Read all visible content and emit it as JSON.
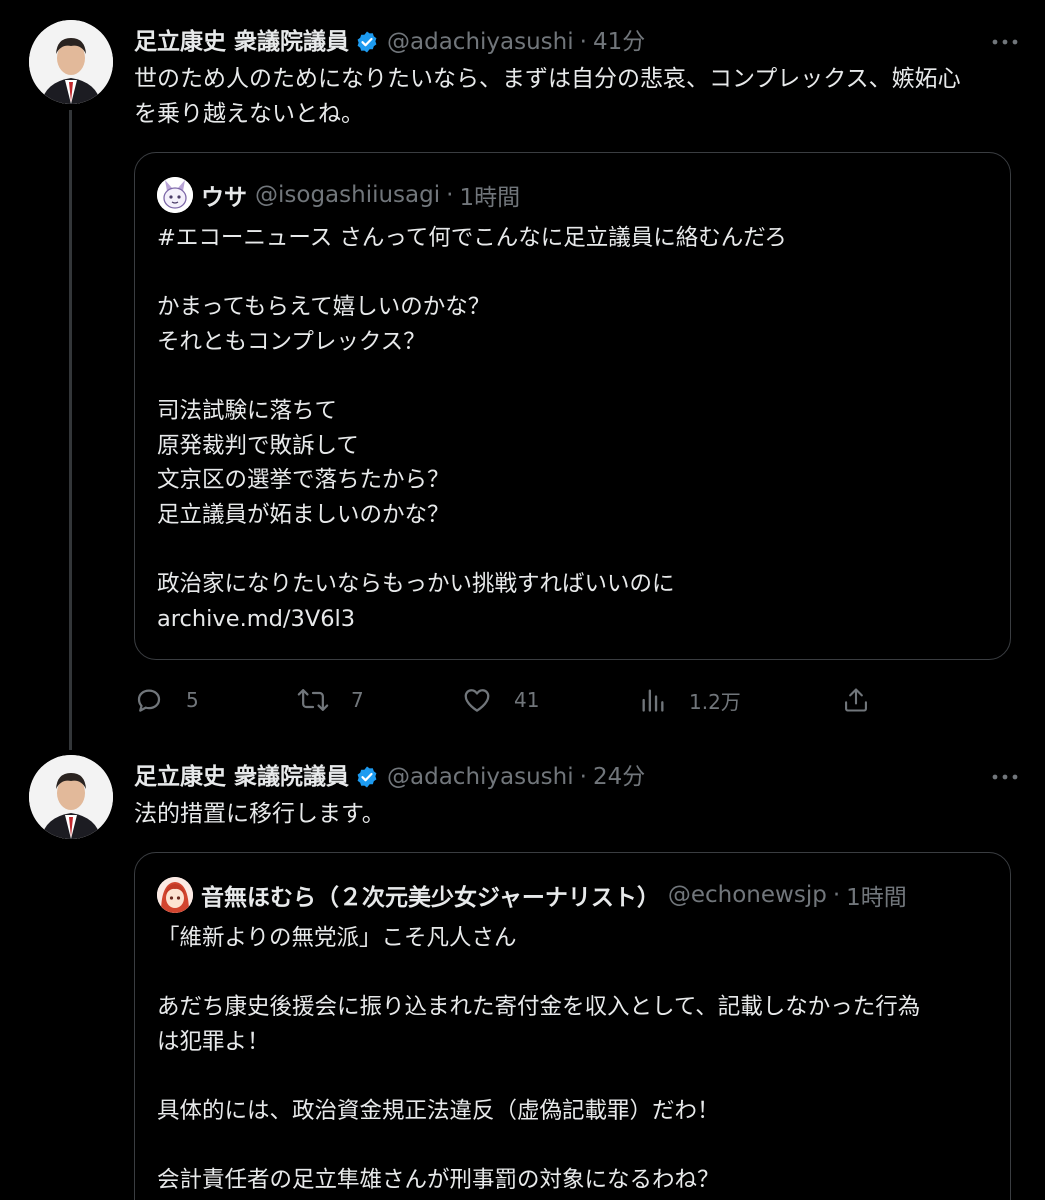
{
  "tweets": [
    {
      "author_name": "足立康史 衆議院議員",
      "handle": "@adachiyasushi",
      "separator": "·",
      "time": "41分",
      "text": "世のため人のためになりたいなら、まずは自分の悲哀、コンプレックス、嫉妬心\nを乗り越えないとね。",
      "quote": {
        "author_name": "ウサ",
        "handle": "@isogashiiusagi",
        "separator": "·",
        "time": "1時間",
        "text": "#エコーニュース さんって何でこんなに足立議員に絡むんだろ\n\nかまってもらえて嬉しいのかな？\nそれともコンプレックス？\n\n司法試験に落ちて\n原発裁判で敗訴して\n文京区の選挙で落ちたから？\n足立議員が妬ましいのかな？\n\n政治家になりたいならもっかい挑戦すればいいのに\narchive.md/3V6l3"
      },
      "actions": {
        "replies": "5",
        "retweets": "7",
        "likes": "41",
        "views": "1.2万"
      }
    },
    {
      "author_name": "足立康史 衆議院議員",
      "handle": "@adachiyasushi",
      "separator": "·",
      "time": "24分",
      "text": "法的措置に移行します。",
      "quote": {
        "author_name": "音無ほむら（２次元美少女ジャーナリスト）",
        "handle": "@echonewsjp",
        "separator": "·",
        "time": "1時間",
        "text": "「維新よりの無党派」こそ凡人さん\n\nあだち康史後援会に振り込まれた寄付金を収入として、記載しなかった行為\nは犯罪よ！\n\n具体的には、政治資金規正法違反（虚偽記載罪）だわ！\n\n会計責任者の足立隼雄さんが刑事罰の対象になるわね？"
      }
    }
  ],
  "icons": {
    "verified": "verified-badge-icon",
    "more": "more-icon",
    "reply": "reply-icon",
    "retweet": "retweet-icon",
    "like": "like-icon",
    "views": "views-icon",
    "share": "share-icon"
  },
  "colors": {
    "background": "#000000",
    "text_primary": "#e7e9ea",
    "text_secondary": "#71767b",
    "verified": "#1d9bf0",
    "border": "#3a3d41"
  }
}
